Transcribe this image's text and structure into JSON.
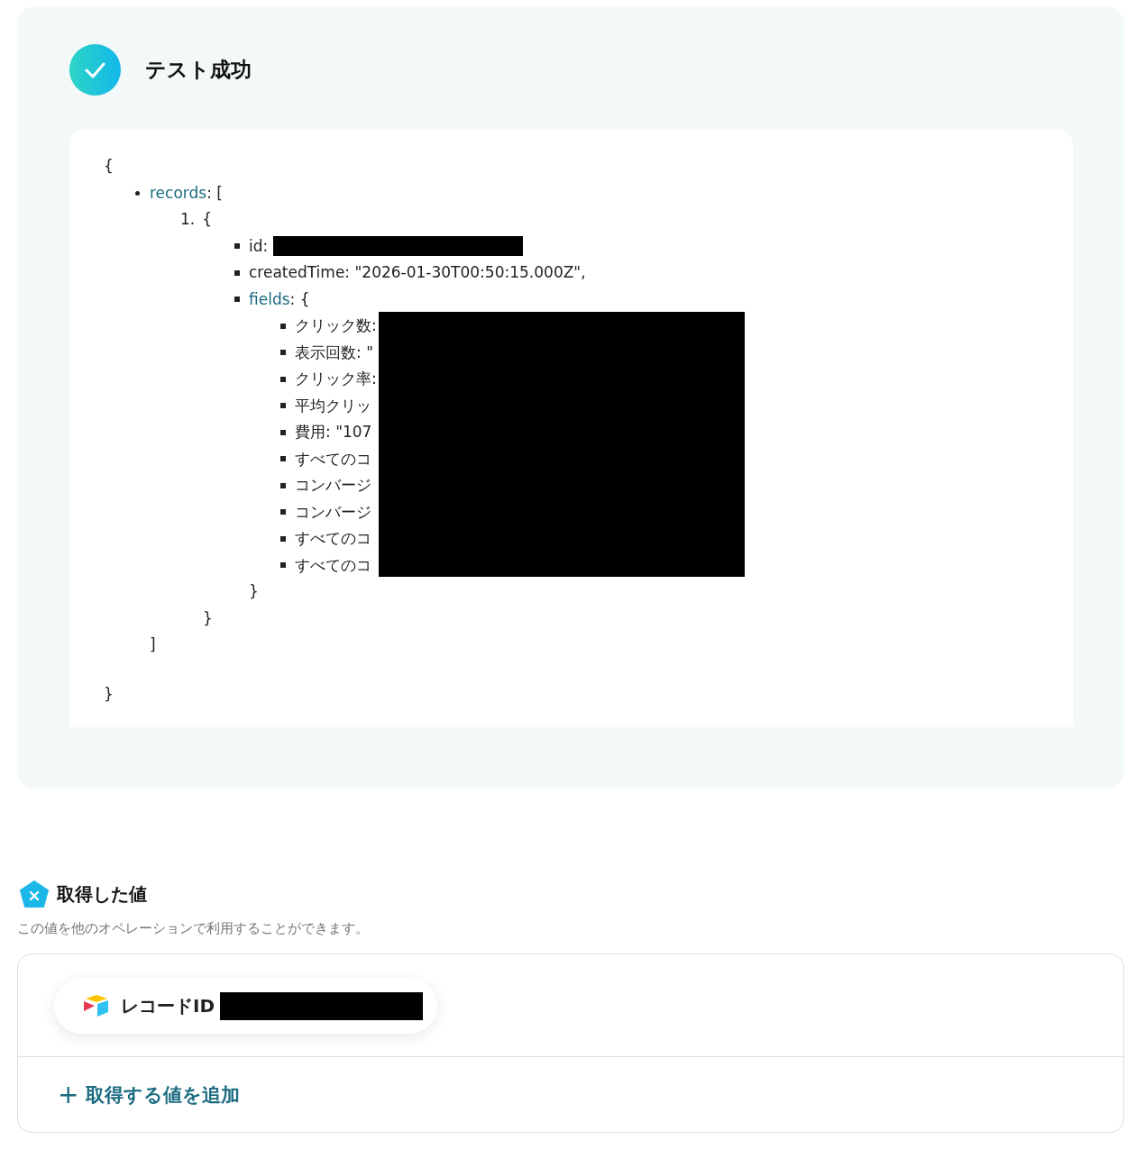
{
  "test_result": {
    "title": "テスト成功",
    "json_view": {
      "opening": "{",
      "closing": "}",
      "children": [
        {
          "key": "records",
          "suffix": ": [",
          "closing": "]",
          "children": [
            {
              "marker": "1.",
              "suffix": "{",
              "closing": "}",
              "children": [
                {
                  "key": "id",
                  "suffix": ":",
                  "redacted": true
                },
                {
                  "key": "createdTime",
                  "suffix": ": \"2026-01-30T00:50:15.000Z\","
                },
                {
                  "key": "fields",
                  "suffix": ": {",
                  "closing": "}",
                  "children_redacted": true,
                  "children": [
                    {
                      "text": "クリック数:"
                    },
                    {
                      "text": "表示回数: \""
                    },
                    {
                      "text": "クリック率:"
                    },
                    {
                      "text": "平均クリッ"
                    },
                    {
                      "text": "費用: \"107"
                    },
                    {
                      "text": "すべてのコ"
                    },
                    {
                      "text": "コンバージ"
                    },
                    {
                      "text": "コンバージ"
                    },
                    {
                      "text": "すべてのコ"
                    },
                    {
                      "text": "すべてのコ"
                    }
                  ]
                }
              ]
            }
          ]
        }
      ]
    }
  },
  "obtained_values": {
    "title": "取得した値",
    "description": "この値を他のオペレーションで利用することができます。",
    "values": [
      {
        "label": "レコードID",
        "redacted": true
      }
    ],
    "add_button": {
      "icon": "+",
      "label": "取得する値を追加"
    }
  }
}
